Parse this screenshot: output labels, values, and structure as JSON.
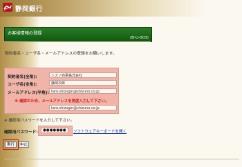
{
  "header": {
    "bank_name": "静岡銀行"
  },
  "title_bar": {
    "title": "お客様情報の登録",
    "code": "(B-U-003)"
  },
  "instruction": "契約者名・ユーザ名・メールアドレスの登録をお願いします。",
  "form": {
    "rows": [
      {
        "label": "契約者名(全角):",
        "value": "シズノ商事株式会社"
      },
      {
        "label": "ユーザ名(全角):",
        "value": "静岡次郎"
      },
      {
        "label": "メールアドレス(半角):",
        "value": "taro.shizugin@shizuno.co.jp"
      },
      {
        "label": "",
        "value": "taro.shizugin@shizuno.co.jp"
      }
    ],
    "warning": "※ 確認のため、メールアドレスを再度入力して下さい。"
  },
  "confirm_note": "※ 確認用パスワードを入力して下さい。",
  "password": {
    "label": "確認用パスワード:",
    "value": "●●●●●●●",
    "software_keyboard_link": "ソフトウェアキーボードを開く"
  },
  "buttons": {
    "execute": "実行",
    "stop": "中止"
  },
  "colors": {
    "brand_red": "#b8141c",
    "title_green": "#1a6a1a",
    "panel_pink": "#f0b4a8",
    "warning_red": "#d41818"
  }
}
